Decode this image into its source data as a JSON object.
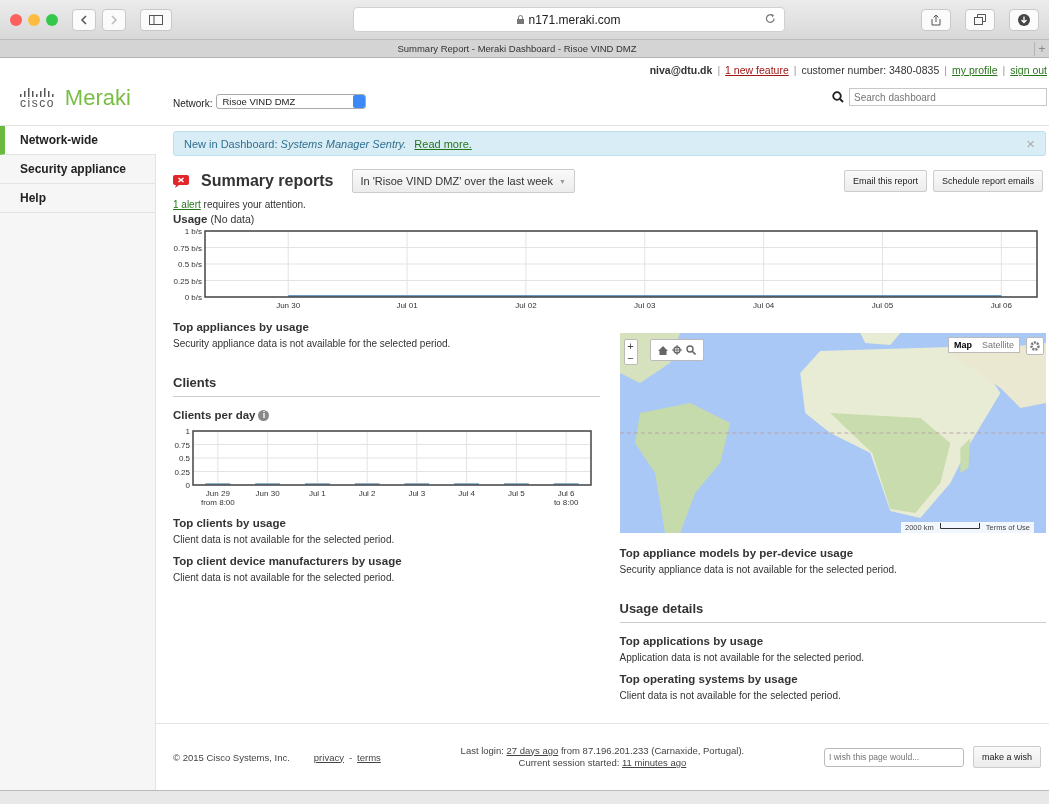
{
  "browser": {
    "url": "n171.meraki.com",
    "tab_title": "Summary Report - Meraki Dashboard - Risoe VIND DMZ",
    "new_tab": "+"
  },
  "header": {
    "logo_mark": "cisco",
    "logo_name": "Meraki",
    "network_label": "Network:",
    "network_value": "Risoe VIND DMZ",
    "user": "niva@dtu.dk",
    "feature_link": "1 new feature",
    "customer_number": "customer number: 3480-0835",
    "profile_link": "my profile",
    "signout_link": "sign out",
    "separator": "|",
    "search_placeholder": "Search dashboard"
  },
  "sidebar": {
    "items": [
      {
        "label": "Network-wide",
        "selected": true
      },
      {
        "label": "Security appliance",
        "selected": false
      },
      {
        "label": "Help",
        "selected": false
      }
    ]
  },
  "banner": {
    "text": "New in Dashboard: *Systems Manager Sentry.*",
    "link": "Read more.",
    "close": "×"
  },
  "report": {
    "title": "Summary reports",
    "filter": "In 'Risoe VIND DMZ' over the last week",
    "filter_caret": "▼",
    "buttons": [
      "Email this report",
      "Schedule report emails"
    ],
    "alert_link": "1 alert",
    "alert_text": "requires your attention."
  },
  "usage": {
    "title": "Usage",
    "note": "(No data)",
    "chart_data": {
      "type": "line",
      "grid": true,
      "categories": [
        "Jun 30",
        "Jul 01",
        "Jul 02",
        "Jul 03",
        "Jul 04",
        "Jul 05",
        "Jul 06"
      ],
      "ylim": [
        0,
        1
      ],
      "yticks": [
        {
          "value": 0,
          "label": "0 b/s"
        },
        {
          "value": 0.25,
          "label": "0.25 b/s"
        },
        {
          "value": 0.5,
          "label": "0.5 b/s"
        },
        {
          "value": 0.75,
          "label": "0.75 b/s"
        },
        {
          "value": 1,
          "label": "1 b/s"
        }
      ],
      "series": [
        {
          "color": "#6b9bc4",
          "values": [
            0,
            0,
            0,
            0,
            0,
            0,
            0
          ]
        }
      ]
    }
  },
  "left_sections": [
    {
      "kind": "section",
      "title": "Top appliances by usage",
      "text": "Security appliance data is not available for the selected period."
    },
    {
      "kind": "heading",
      "title": "Clients"
    },
    {
      "kind": "chart",
      "title": "Clients per day",
      "info": "i",
      "chart_data": {
        "type": "bar",
        "grid": true,
        "categories": [
          "Jun 29\nfrom 8:00",
          "Jun 30",
          "Jul 1",
          "Jul 2",
          "Jul 3",
          "Jul 4",
          "Jul 5",
          "Jul 6\nto 8:00"
        ],
        "ylim": [
          0,
          1
        ],
        "yticks": [
          {
            "value": 0,
            "label": "0"
          },
          {
            "value": 0.25,
            "label": "0.25"
          },
          {
            "value": 0.5,
            "label": "0.5"
          },
          {
            "value": 0.75,
            "label": "0.75"
          },
          {
            "value": 1,
            "label": "1"
          }
        ],
        "series": [
          {
            "color": "#8fb4cc",
            "values": [
              0,
              0,
              0,
              0,
              0,
              0,
              0,
              0
            ]
          }
        ]
      }
    },
    {
      "kind": "section",
      "title": "Top clients by usage",
      "text": "Client data is not available for the selected period."
    },
    {
      "kind": "section",
      "title": "Top client device manufacturers by usage",
      "text": "Client data is not available for the selected period."
    }
  ],
  "map": {
    "kind": "picture",
    "zoom_in": "+",
    "zoom_out": "−",
    "types": [
      {
        "label": "Map",
        "selected": true
      },
      {
        "label": "Satellite",
        "selected": false
      }
    ],
    "scale": "2000 km",
    "terms": "Terms of Use"
  },
  "right_sections": [
    {
      "kind": "section",
      "title": "Top appliance models by per-device usage",
      "text": "Security appliance data is not available for the selected period."
    },
    {
      "kind": "heading",
      "title": "Usage details"
    },
    {
      "kind": "section",
      "title": "Top applications by usage",
      "text": "Application data is not available for the selected period."
    },
    {
      "kind": "section",
      "title": "Top operating systems by usage",
      "text": "Client data is not available for the selected period."
    }
  ],
  "footer": {
    "copyright": "© 2015 Cisco Systems, Inc.",
    "privacy": "privacy",
    "separator": "-",
    "terms": "terms",
    "login_prefix": "Last login:",
    "login_link": "27 days ago",
    "login_suffix": "from 87.196.201.233 (Carnaxide, Portugal).",
    "session_prefix": "Current session started:",
    "session_link": "11 minutes ago",
    "wish_placeholder": "I wish this page would...",
    "wish_button": "make a wish"
  }
}
